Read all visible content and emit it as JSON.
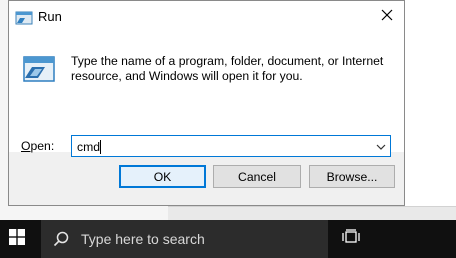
{
  "dialog": {
    "title": "Run",
    "description_line1": "Type the name of a program, folder, document, or Internet",
    "description_line2": "resource, and Windows will open it for you.",
    "open_label_prefix": "O",
    "open_label_rest": "pen:",
    "input_value": "cmd",
    "buttons": {
      "ok": "OK",
      "cancel": "Cancel",
      "browse": "Browse..."
    }
  },
  "taskbar": {
    "search_placeholder": "Type here to search"
  },
  "icons": {
    "run": "run-icon",
    "close": "close-icon",
    "dropdown": "chevron-down-icon",
    "start": "windows-icon",
    "search": "search-icon",
    "taskview": "task-view-icon"
  },
  "colors": {
    "accent": "#0078d7",
    "taskbar": "#101010",
    "search_box": "#2c2c2c"
  }
}
